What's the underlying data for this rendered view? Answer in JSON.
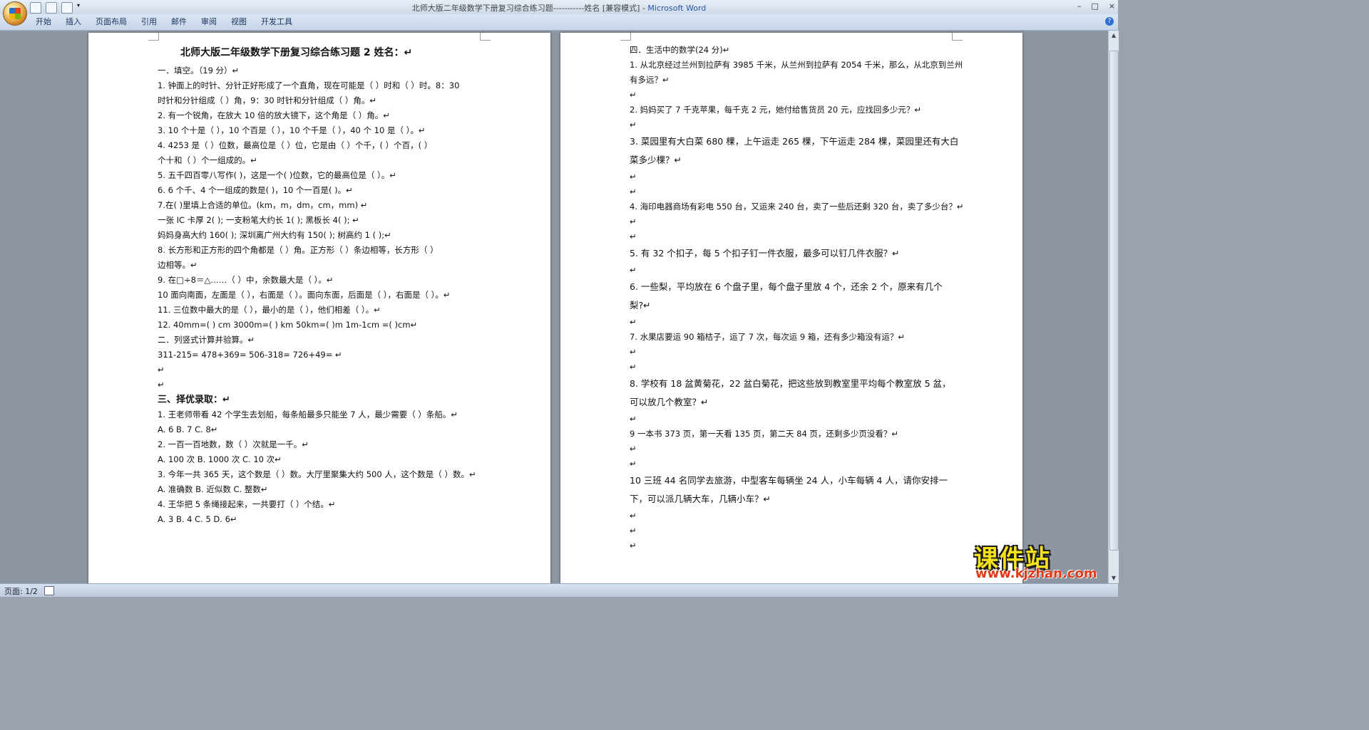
{
  "window": {
    "title": "北师大版二年级数学下册复习综合练习题-----------姓名 [兼容模式] - ",
    "app": "Microsoft Word",
    "controls": [
      "–",
      "□",
      "×"
    ]
  },
  "ribbon": {
    "tabs": [
      "开始",
      "插入",
      "页面布局",
      "引用",
      "邮件",
      "审阅",
      "视图",
      "开发工具"
    ],
    "help": "?"
  },
  "page1": {
    "title": "北师大版二年级数学下册复习综合练习题 2      姓名：↵",
    "lines": [
      "一．填空。（19 分）↵",
      "1. 钟面上的时针、分针正好形成了一个直角，现在可能是（       ）时和（     ）时。8：30",
      "时针和分针组成（      ）角，9：30 时针和分针组成（        ）角。↵",
      "2. 有一个锐角，在放大 10 倍的放大镜下，这个角是（            ）角。↵",
      "3. 10 个十是（         ），10 个百是（       ），10 个千是（         ），40 个 10 是（       ）。↵",
      "4. 4253 是（      ）位数，最高位是（        ）位，它是由（      ）个千，(       ）个百，(       ）",
      "个十和（        ）个一组成的。↵",
      "5. 五千四百零八写作(                     )，这是一个(         )位数，它的最高位是（      ）。↵",
      "6.        6 个千、4 个一组成的数是(                  )，10 个一百是(                  )。↵",
      "7.在(      )里填上合适的单位。(km，m，dm，cm，mm) ↵",
      "一张 IC 卡厚 2(          );              一支粉笔大约长 1(          );                   黑板长 4(          );        ↵",
      "妈妈身高大约 160(          );         深圳离广州大约有 150(          );              树高约 1 (          );↵",
      "8. 长方形和正方形的四个角都是（       ）角。正方形（      ）条边相等，长方形（         ）",
      "边相等。↵",
      "9. 在□÷8＝△……（             ）中，余数最大是（              ）。↵",
      "10 面向南面，左面是（     ），右面是（     ）。面向东面，后面是（     ），右面是（      ）。↵",
      "11. 三位数中最大的是（    ），最小的是（    ），他们相差（       ）。↵",
      "12.      40mm=(      ) cm   3000m=(      )  km    50km=(      )m     1m-1cm =(      )cm↵",
      "二．列竖式计算并验算。↵",
      "311-215=                    478+369=                    506-318=                      726+49=           ↵",
      "↵",
      "↵",
      "三、择优录取：↵",
      "1. 王老师带看 42 个学生去划船，每条船最多只能坐 7 人，最少需要（   ）条船。↵",
      "A. 6          B. 7          C. 8↵",
      "2. 一百一百地数，数（       ）次就是一千。↵",
      "A. 100 次          B. 1000 次          C. 10 次↵",
      "3. 今年一共 365 天，这个数是（   ）数。大厅里聚集大约 500 人，这个数是（   ）数。↵",
      "A. 准确数        B. 近似数        C. 整数↵",
      "4. 王华把 5 条绳接起来，一共要打（      ）个结。↵",
      "A. 3          B. 4          C. 5          D. 6↵"
    ]
  },
  "page2": {
    "lines": [
      "四．生活中的数学(24 分)↵",
      "1. 从北京经过兰州到拉萨有 3985 千米，从兰州到拉萨有 2054 千米，那么，从北京到兰州",
      "有多远？↵",
      "↵",
      "2. 妈妈买了 7 千克苹果，每千克 2 元，她付给售货员 20 元，应找回多少元？↵",
      "↵",
      "3. 菜园里有大白菜 680 棵，上午运走 265 棵，下午运走 284 棵，菜园里还有大白",
      "菜多少棵？↵",
      "↵",
      "↵",
      "4. 海印电器商场有彩电 550 台，又运来 240 台，卖了一些后还剩 320 台，卖了多少台？↵",
      "↵",
      "↵",
      "5. 有 32 个扣子，每 5 个扣子钉一件衣服，最多可以钉几件衣服？↵",
      "↵",
      "6. 一些梨，平均放在 6 个盘子里，每个盘子里放 4 个，还余 2 个，原来有几个",
      "梨?↵",
      "↵",
      "7. 水果店要运 90 箱桔子，运了 7 次，每次运 9 箱，还有多少箱没有运？↵",
      "↵",
      "↵",
      "8. 学校有 18 盆黄菊花，22 盆白菊花，把这些放到教室里平均每个教室放 5 盆，",
      "可以放几个教室？↵",
      "↵",
      "9 一本书 373 页，第一天看 135 页，第二天 84 页，还剩多少页没看？↵",
      "↵",
      "↵",
      "10 三班  44 名同学去旅游，中型客车每辆坐 24 人，小车每辆 4 人，请你安排一",
      "下，可以派几辆大车，几辆小车？↵",
      "↵",
      "↵",
      "↵"
    ]
  },
  "status": {
    "page": "页面: 1/2"
  },
  "watermark": {
    "main": "课件站",
    "url": "www.kjzhan.com"
  },
  "colors": {
    "watermark_yellow": "#f6e21a",
    "watermark_red": "#e23a19",
    "app_title_blue": "#2a56a8"
  }
}
